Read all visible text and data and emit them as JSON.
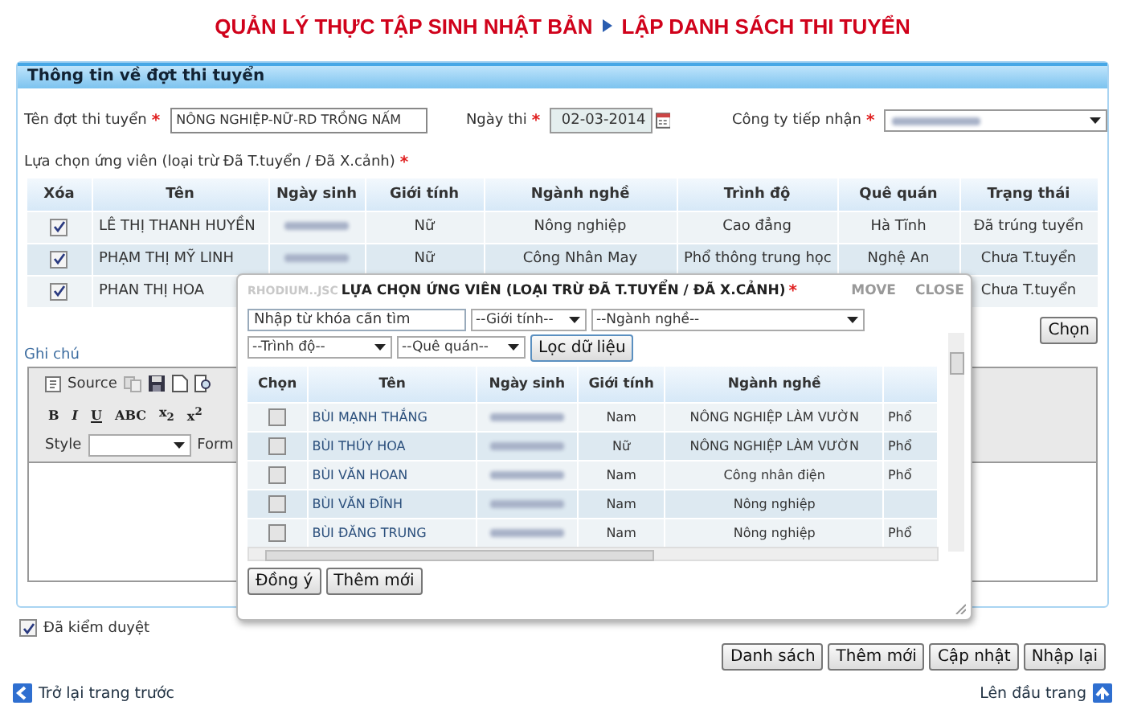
{
  "page_title": {
    "left": "QUẢN LÝ THỰC TẬP SINH NHẬT BẢN",
    "right": "LẬP DANH SÁCH THI TUYỂN"
  },
  "panel": {
    "title": "Thông tin về đợt thi tuyển",
    "fields": [
      {
        "kind": "text",
        "label": "Tên đợt thi tuyển",
        "required_mark": "*",
        "value": "NÔNG NGHIỆP-NỮ-RD TRỒNG NẤM"
      },
      {
        "kind": "date",
        "label": "Ngày thi",
        "required_mark": "*",
        "value": "02-03-2014"
      },
      {
        "kind": "select",
        "label": "Công ty tiếp nhận",
        "required_mark": "*"
      }
    ],
    "candidates_label": "Lựa chọn ứng viên (loại trừ Đã T.tuyển / Đã X.cảnh)",
    "candidates_required_mark": "*",
    "columns": [
      "Xóa",
      "Tên",
      "Ngày sinh",
      "Giới tính",
      "Ngành nghề",
      "Trình độ",
      "Quê quán",
      "Trạng thái"
    ],
    "rows": [
      {
        "checked": true,
        "name": "LÊ THỊ THANH HUYỀN",
        "gender": "Nữ",
        "occupation": "Nông nghiệp",
        "education": "Cao đẳng",
        "hometown": "Hà Tĩnh",
        "status": "Đã trúng tuyển"
      },
      {
        "checked": true,
        "name": "PHẠM THỊ MỸ LINH",
        "gender": "Nữ",
        "occupation": "Công Nhân  May",
        "education": "Phổ thông trung học",
        "hometown": "Nghệ An",
        "status": "Chưa T.tuyển"
      },
      {
        "checked": true,
        "name": "PHAN THỊ HOA",
        "status": "Chưa T.tuyển"
      }
    ],
    "choose_button": "Chọn",
    "note_label": "Ghi chú",
    "editor": {
      "source": "Source",
      "format_buttons": [
        "B",
        "I",
        "U",
        "ABC",
        "x$_{2}$",
        "x$^{2}$"
      ],
      "style_label": "Style",
      "format_label": "Form"
    }
  },
  "approved": {
    "label": "Đã kiểm duyệt",
    "checked": true
  },
  "actions": [
    "Danh sách",
    "Thêm mới",
    "Cập nhật",
    "Nhập lại"
  ],
  "footer": {
    "back": "Trở lại trang trước",
    "top": "Lên đầu trang"
  },
  "dialog": {
    "brand": "RHODIUM..JSC",
    "title": "LỰA CHỌN ỨNG VIÊN (LOẠI TRỪ ĐÃ T.TUYỂN / ĐÃ X.CẢNH)",
    "required_mark": "*",
    "move": "MOVE",
    "close": "CLOSE",
    "search": {
      "placeholder": "Nhập từ khóa cần tìm"
    },
    "filters": [
      "--Giới tính--",
      "--Ngành nghề--",
      "--Trình độ--",
      "--Quê quán--"
    ],
    "filter_button": "Lọc dữ liệu",
    "columns": [
      "Chọn",
      "Tên",
      "Ngày sinh",
      "Giới tính",
      "Ngành nghề"
    ],
    "rows": [
      {
        "checked": false,
        "name": "BÙI MẠNH THẮNG",
        "gender": "Nam",
        "occupation": "NÔNG NGHIỆP LÀM VƯỜN",
        "column_6": "Phổ"
      },
      {
        "checked": false,
        "name": "BÙI THÚY HOA",
        "gender": "Nữ",
        "occupation": "NÔNG NGHIỆP LÀM VƯỜN",
        "column_6": "Phổ"
      },
      {
        "checked": false,
        "name": "BÙI VĂN HOAN",
        "gender": "Nam",
        "occupation": "Công nhân điện",
        "column_6": "Phổ"
      },
      {
        "checked": false,
        "name": "BÙI VĂN ĐĨNH",
        "gender": "Nam",
        "occupation": "Nông nghiệp"
      },
      {
        "checked": false,
        "name": "BÙI ĐĂNG TRUNG",
        "gender": "Nam",
        "occupation": "Nông nghiệp",
        "column_6": "Phổ"
      }
    ],
    "buttons": [
      "Đồng ý",
      "Thêm mới"
    ]
  }
}
